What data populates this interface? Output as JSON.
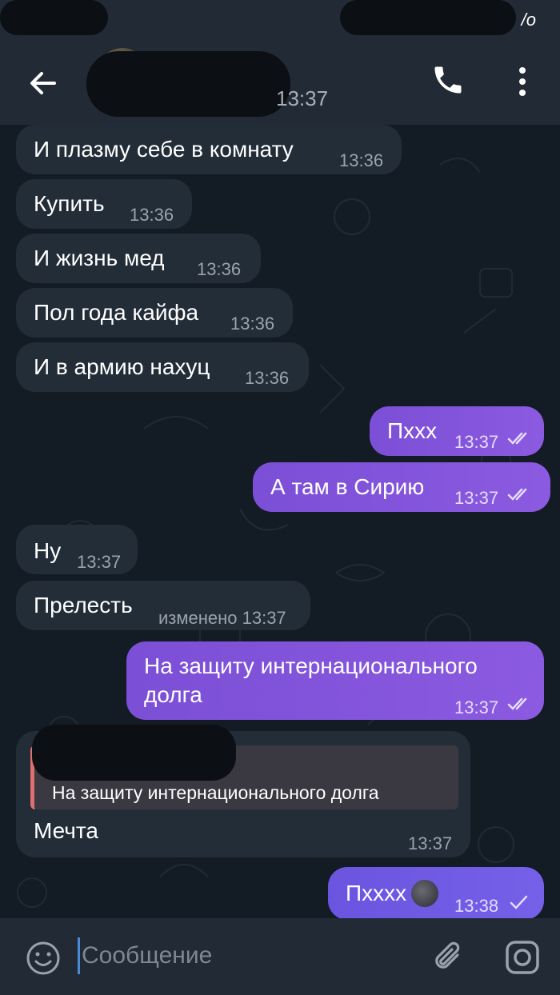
{
  "status_bar": {
    "icon_text": "/o"
  },
  "header": {
    "time": "13:37"
  },
  "messages": [
    {
      "text": "И плазму себе в комнату",
      "time": "13:36"
    },
    {
      "text": "Купить",
      "time": "13:36"
    },
    {
      "text": "И жизнь мед",
      "time": "13:36"
    },
    {
      "text": "Пол года кайфа",
      "time": "13:36"
    },
    {
      "text": "И в армию нахуц",
      "time": "13:36"
    },
    {
      "text": "Пххх",
      "time": "13:37"
    },
    {
      "text": "А там в Сирию",
      "time": "13:37"
    },
    {
      "text": "Ну",
      "time": "13:37"
    },
    {
      "text": "Прелесть",
      "time": "изменено 13:37"
    },
    {
      "text_line1": "На защиту интернационального",
      "text_line2": "долга",
      "time": "13:37"
    },
    {
      "reply_quote": "На защиту интернационального долга",
      "text": "Мечта",
      "time": "13:37"
    },
    {
      "text": "Пхххх",
      "time": "13:38"
    }
  ],
  "input": {
    "placeholder": "Сообщение"
  },
  "colors": {
    "outgoing": "#7b4fd6",
    "incoming": "#232d38",
    "header": "#222b35",
    "background": "#131b24"
  }
}
